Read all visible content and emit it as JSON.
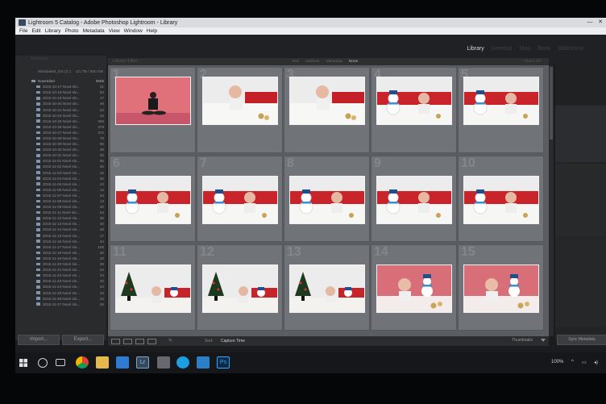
{
  "app": {
    "title": "Lightroom 5 Catalog - Adobe Photoshop Lightroom - Library",
    "menu": [
      "File",
      "Edit",
      "Library",
      "Photo",
      "Metadata",
      "View",
      "Window",
      "Help"
    ],
    "modules": [
      "Library",
      "Develop",
      "Map",
      "Book",
      "Slideshow"
    ],
    "active_module": "Library",
    "window_buttons": {
      "minimize": "—",
      "close": "✕"
    }
  },
  "navigator": {
    "label": "Navigator"
  },
  "left_panel": {
    "volume": {
      "name": "Windows8_OS (C:)",
      "info": "1/1 TB / 500 GB"
    },
    "root_folder": {
      "name": "November",
      "count": "3509"
    },
    "folders": [
      {
        "name": "2015-10-17 Nové slo...",
        "count": "31"
      },
      {
        "name": "2015-10-18 Nové slo...",
        "count": "53"
      },
      {
        "name": "2015-10-19 Nové slo...",
        "count": "17"
      },
      {
        "name": "2015-10-20 Nové slo...",
        "count": "46"
      },
      {
        "name": "2015-10-21 Nové slo...",
        "count": "23"
      },
      {
        "name": "2015-10-22 Nové slo...",
        "count": "34"
      },
      {
        "name": "2015-10-25 Nové slo...",
        "count": "400"
      },
      {
        "name": "2015-10-26 Nové slo...",
        "count": "479"
      },
      {
        "name": "2015-10-27 Nové slo...",
        "count": "372"
      },
      {
        "name": "2015-10-28 Nové slo...",
        "count": "78"
      },
      {
        "name": "2015-10-29 Nové slo...",
        "count": "96"
      },
      {
        "name": "2015-10-30 Nové slo...",
        "count": "48"
      },
      {
        "name": "2015-10-31 Nové slo...",
        "count": "30"
      },
      {
        "name": "2015-11-01 Nové slo...",
        "count": "55"
      },
      {
        "name": "2015-11-02 Nové slo...",
        "count": "36"
      },
      {
        "name": "2015-11-03 Nové slo...",
        "count": "42"
      },
      {
        "name": "2015-11-04 Nové slo...",
        "count": "30"
      },
      {
        "name": "2015-11-05 Nové slo...",
        "count": "24"
      },
      {
        "name": "2015-11-06 Nové slo...",
        "count": "14"
      },
      {
        "name": "2015-11-07 Nové slo...",
        "count": "34"
      },
      {
        "name": "2015-11-08 Nové slo...",
        "count": "13"
      },
      {
        "name": "2015-11-09 Nové slo...",
        "count": "20"
      },
      {
        "name": "2015-11-11 Nové slo...",
        "count": "54"
      },
      {
        "name": "2015-11-12 Nové slo...",
        "count": "36"
      },
      {
        "name": "2015-11-13 Nové slo...",
        "count": "40"
      },
      {
        "name": "2015-11-14 Nové slo...",
        "count": "48"
      },
      {
        "name": "2015-11-15 Nové slo...",
        "count": "17"
      },
      {
        "name": "2015-11-16 Nové slo...",
        "count": "24"
      },
      {
        "name": "2015-11-17 Nové slo...",
        "count": "105"
      },
      {
        "name": "2015-11-18 Nové slo...",
        "count": "30"
      },
      {
        "name": "2015-11-19 Nové slo...",
        "count": "33"
      },
      {
        "name": "2015-11-20 Nové slo...",
        "count": "36"
      },
      {
        "name": "2015-11-21 Nové slo...",
        "count": "24"
      },
      {
        "name": "2015-11-22 Nové slo...",
        "count": "34"
      },
      {
        "name": "2015-11-23 Nové slo...",
        "count": "20"
      },
      {
        "name": "2015-11-24 Nové slo...",
        "count": "24"
      },
      {
        "name": "2015-11-25 Nové slo...",
        "count": "33"
      },
      {
        "name": "2015-11-26 Nové slo...",
        "count": "34"
      },
      {
        "name": "2015-11-27 Nové slo...",
        "count": "26"
      }
    ],
    "import_label": "Import...",
    "export_label": "Export..."
  },
  "library_filter": {
    "label": "Library Filter :",
    "options": [
      "Text",
      "Attribute",
      "Metadata",
      "None"
    ],
    "active": "None",
    "preset": "Filters Off"
  },
  "grid": {
    "cells": [
      {
        "num": "1",
        "scene": "studio"
      },
      {
        "num": "2",
        "scene": "baby"
      },
      {
        "num": "3",
        "scene": "baby"
      },
      {
        "num": "4",
        "scene": "snowman"
      },
      {
        "num": "5",
        "scene": "snowman"
      },
      {
        "num": "6",
        "scene": "snowman"
      },
      {
        "num": "7",
        "scene": "snowman"
      },
      {
        "num": "8",
        "scene": "snowman"
      },
      {
        "num": "9",
        "scene": "snowman"
      },
      {
        "num": "10",
        "scene": "snowman"
      },
      {
        "num": "11",
        "scene": "tree"
      },
      {
        "num": "12",
        "scene": "tree"
      },
      {
        "num": "13",
        "scene": "tree"
      },
      {
        "num": "14",
        "scene": "pink"
      },
      {
        "num": "15",
        "scene": "pink"
      }
    ]
  },
  "toolbar": {
    "sort_label": "Sort:",
    "sort_value": "Capture Time",
    "thumbnails_label": "Thumbnails"
  },
  "right_panel": {
    "sync_label": "Sync Metadata"
  },
  "taskbar": {
    "apps": [
      "start",
      "search",
      "task-view",
      "chrome",
      "explorer",
      "store",
      "lightroom",
      "calculator",
      "skype",
      "photos",
      "photoshop"
    ],
    "tray_battery": "100%"
  },
  "colors": {
    "lightroom_bg": "#1b1c1e",
    "grid_bg": "#5a5d61",
    "thumb_red": "#c2262b",
    "thumb_pink": "#d56a72"
  }
}
